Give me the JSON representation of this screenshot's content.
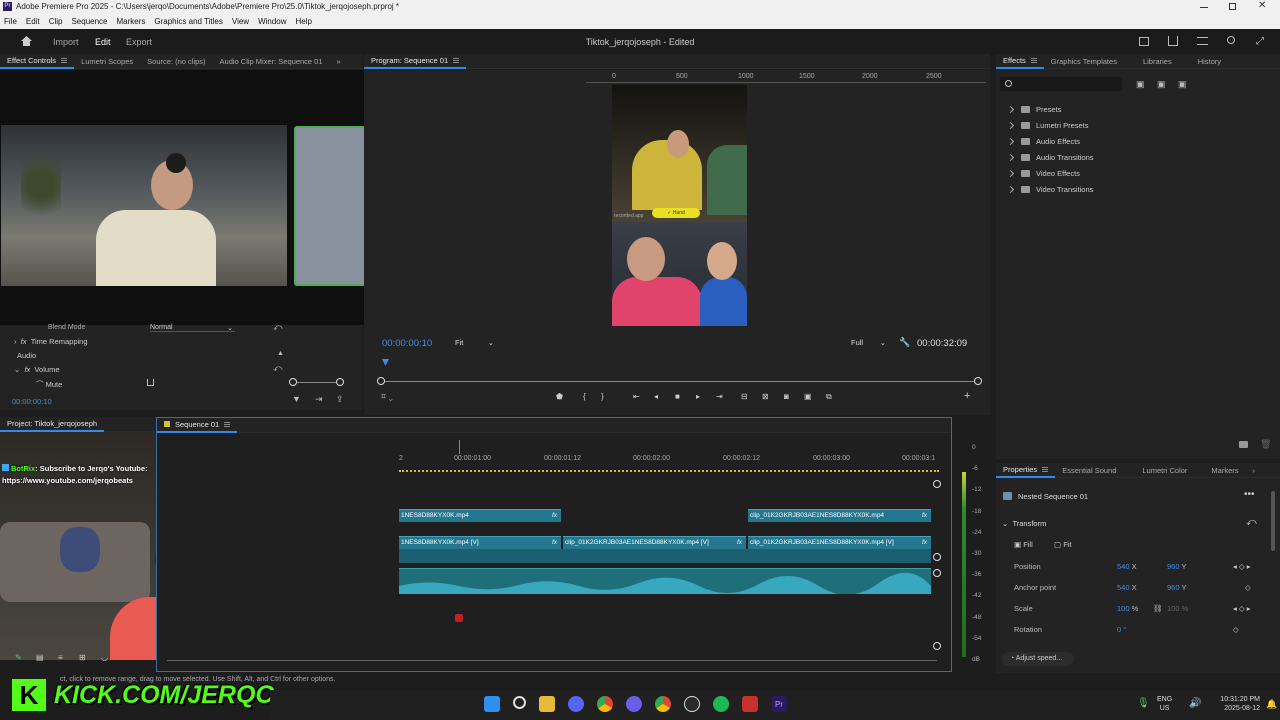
{
  "titlebar": {
    "title": "Adobe Premiere Pro 2025 - C:\\Users\\jerqo\\Documents\\Adobe\\Premiere Pro\\25.0\\Tiktok_jerqojoseph.prproj *"
  },
  "menu": [
    "File",
    "Edit",
    "Clip",
    "Sequence",
    "Markers",
    "Graphics and Titles",
    "View",
    "Window",
    "Help"
  ],
  "workspace": {
    "tabs": [
      "Import",
      "Edit",
      "Export"
    ],
    "active": "Edit",
    "project_status": "Tiktok_jerqojoseph - Edited"
  },
  "source_panel": {
    "tabs": [
      "Effect Controls",
      "Lumetri Scopes",
      "Source: (no clips)",
      "Audio Clip Mixer: Sequence 01"
    ],
    "blend_mode_label": "Blend Mode",
    "blend_mode_value": "Normal",
    "time_remapping": "Time Remapping",
    "audio_section": "Audio",
    "volume": "Volume",
    "mute": "Mute",
    "timecode": "00:00:00:10"
  },
  "program_monitor": {
    "tab": "Program: Sequence 01",
    "ruler": [
      "0",
      "500",
      "1000",
      "1500",
      "2000",
      "2500"
    ],
    "current_time": "00:00:00:10",
    "fit": "Fit",
    "quality": "Full",
    "duration": "00:00:32:09",
    "frame_button": "✓ Hand",
    "frame_watermark": "recorded.app"
  },
  "project_panel": {
    "tab": "Project: Tiktok_jerqojoseph"
  },
  "timeline": {
    "tab": "Sequence 01",
    "ruler": [
      "2",
      "00:00:01:00",
      "00:00:01:12",
      "00:00:02:00",
      "00:00:02:12",
      "00:00:03:00",
      "00:00:03:1"
    ],
    "clips_v2": [
      "1NES8D88KYX0K.mp4",
      "clip_01K2GKRJB03AE1NES8D88KYX0K.mp4"
    ],
    "clips_v1": [
      "1NES8D88KYX0K.mp4 [V]",
      "clip_01K2GKRJB03AE1NES8D88KYX0K.mp4 [V]",
      "clip_01K2GKRJB03AE1NES8D88KYX0K.mp4 [V]"
    ],
    "fx": "fx"
  },
  "audio_meter": {
    "scale": [
      "0",
      "-6",
      "-12",
      "-18",
      "-24",
      "-30",
      "-36",
      "-42",
      "-48",
      "-54",
      "dB"
    ]
  },
  "effects_panel": {
    "tabs": [
      "Effects",
      "Graphics Templates",
      "Libraries",
      "History"
    ],
    "items": [
      "Presets",
      "Lumetri Presets",
      "Audio Effects",
      "Audio Transitions",
      "Video Effects",
      "Video Transitions"
    ]
  },
  "properties_panel": {
    "tabs": [
      "Properties",
      "Essential Sound",
      "Lumetri Color",
      "Markers"
    ],
    "item": "Nested Sequence 01",
    "section": "Transform",
    "fill": "Fill",
    "fit": "Fit",
    "position": {
      "label": "Position",
      "x": "540",
      "y": "960"
    },
    "anchor": {
      "label": "Anchor point",
      "x": "540",
      "y": "960"
    },
    "scale": {
      "label": "Scale",
      "value": "100",
      "value2": "100"
    },
    "rotation": {
      "label": "Rotation",
      "value": "0"
    },
    "adjust_speed": "Adjust speed..."
  },
  "chat": {
    "user": "BotRix",
    "message": ": Subscribe to Jerqo's Youtube:",
    "link": "https://www.youtube.com/jerqobeats"
  },
  "kick_banner": "KICK.COM/JERQO",
  "status_bar": "ct, click to remove range, drag to move selected. Use Shift, Alt, and Ctrl for other options.",
  "taskbar": {
    "lang": "ENG",
    "region": "US",
    "time": "10:31:20 PM",
    "date": "2025-08-12"
  },
  "colors": {
    "accent": "#2d8ceb",
    "clip_video": "#25778f",
    "clip_audio": "#1f6f7a",
    "discord_bg": "#8a919e",
    "kick_green": "#53fc18"
  }
}
